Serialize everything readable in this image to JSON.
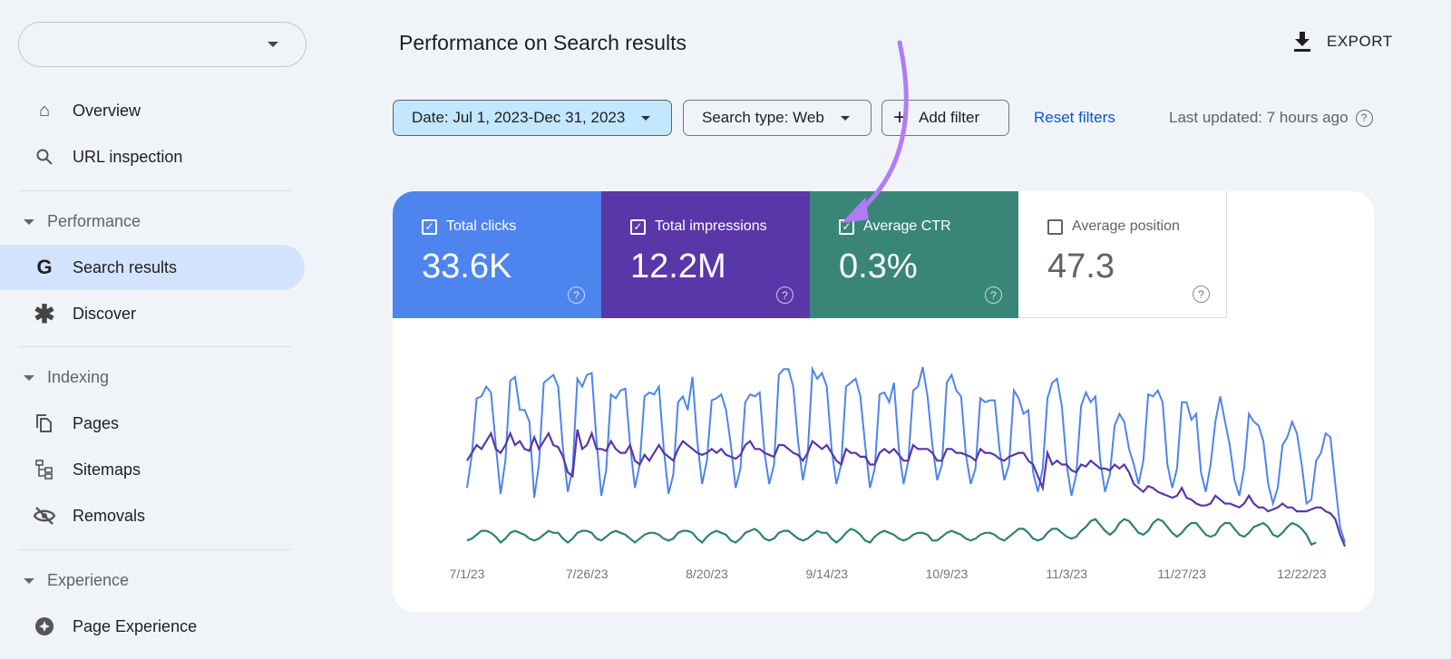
{
  "sidebar": {
    "property_selector": "",
    "items": {
      "overview": "Overview",
      "url_inspection": "URL inspection",
      "performance": "Performance",
      "search_results": "Search results",
      "discover": "Discover",
      "indexing": "Indexing",
      "pages": "Pages",
      "sitemaps": "Sitemaps",
      "removals": "Removals",
      "experience": "Experience",
      "page_experience": "Page Experience"
    }
  },
  "header": {
    "title": "Performance on Search results",
    "export": "EXPORT"
  },
  "filters": {
    "date": "Date: Jul 1, 2023-Dec 31, 2023",
    "search_type": "Search type: Web",
    "add_filter": "Add filter",
    "reset": "Reset filters",
    "last_updated": "Last updated: 7 hours ago"
  },
  "metrics": [
    {
      "label": "Total clicks",
      "value": "33.6K",
      "checked": true,
      "color": "#4e84ee"
    },
    {
      "label": "Total impressions",
      "value": "12.2M",
      "checked": true,
      "color": "#5a37a8"
    },
    {
      "label": "Average CTR",
      "value": "0.3%",
      "checked": true,
      "color": "#398679"
    },
    {
      "label": "Average position",
      "value": "47.3",
      "checked": false,
      "color": "#ffffff"
    }
  ],
  "annotation": {
    "arrow_color": "#b07cf5"
  },
  "chart_data": {
    "type": "line",
    "x_start": "7/1/23",
    "x_end": "12/31/23",
    "x_tick_labels": [
      "7/1/23",
      "7/26/23",
      "8/20/23",
      "9/14/23",
      "10/9/23",
      "11/3/23",
      "11/27/23",
      "12/22/23"
    ],
    "x_tick_day_offsets": [
      0,
      25,
      50,
      75,
      100,
      125,
      149,
      174
    ],
    "grid": false,
    "y_axis": "hidden (relative scale)",
    "series": [
      {
        "name": "Total clicks",
        "color": "#4e84ee",
        "values": [
          38,
          55,
          84,
          85,
          90,
          87,
          60,
          35,
          52,
          93,
          95,
          78,
          78,
          72,
          33,
          50,
          92,
          94,
          96,
          90,
          58,
          36,
          48,
          94,
          90,
          96,
          97,
          62,
          34,
          47,
          86,
          84,
          88,
          89,
          60,
          38,
          50,
          85,
          87,
          86,
          90,
          58,
          35,
          45,
          82,
          85,
          78,
          95,
          62,
          40,
          52,
          83,
          84,
          86,
          78,
          60,
          38,
          48,
          82,
          86,
          85,
          87,
          56,
          40,
          50,
          96,
          99,
          99,
          90,
          62,
          42,
          55,
          99,
          94,
          97,
          90,
          58,
          40,
          50,
          90,
          92,
          94,
          85,
          60,
          38,
          48,
          86,
          87,
          82,
          92,
          58,
          40,
          52,
          88,
          90,
          100,
          85,
          60,
          42,
          50,
          92,
          96,
          88,
          85,
          55,
          40,
          48,
          84,
          82,
          83,
          83,
          58,
          42,
          50,
          88,
          84,
          76,
          78,
          46,
          36,
          48,
          84,
          92,
          94,
          80,
          50,
          34,
          45,
          80,
          87,
          82,
          85,
          52,
          36,
          45,
          70,
          76,
          72,
          58,
          50,
          40,
          52,
          86,
          85,
          88,
          82,
          50,
          38,
          48,
          82,
          82,
          73,
          76,
          46,
          36,
          50,
          72,
          85,
          72,
          60,
          42,
          34,
          48,
          76,
          72,
          70,
          62,
          40,
          30,
          38,
          60,
          64,
          72,
          66,
          50,
          30,
          32,
          52,
          56,
          66,
          64,
          40,
          18,
          10
        ]
      },
      {
        "name": "Total impressions",
        "color": "#5a37a8",
        "values": [
          52,
          56,
          60,
          58,
          62,
          66,
          58,
          56,
          60,
          66,
          60,
          62,
          58,
          57,
          64,
          58,
          62,
          66,
          60,
          59,
          54,
          46,
          44,
          68,
          58,
          60,
          66,
          58,
          58,
          57,
          62,
          58,
          56,
          56,
          60,
          52,
          50,
          55,
          52,
          56,
          60,
          56,
          54,
          52,
          58,
          62,
          60,
          58,
          56,
          55,
          56,
          58,
          56,
          58,
          55,
          54,
          53,
          55,
          60,
          62,
          58,
          58,
          56,
          55,
          54,
          60,
          60,
          58,
          56,
          55,
          52,
          56,
          62,
          60,
          58,
          60,
          56,
          52,
          50,
          58,
          56,
          56,
          54,
          54,
          50,
          50,
          56,
          58,
          56,
          58,
          55,
          52,
          52,
          60,
          58,
          58,
          58,
          56,
          52,
          52,
          58,
          58,
          56,
          56,
          55,
          54,
          52,
          58,
          56,
          56,
          55,
          53,
          52,
          54,
          55,
          56,
          56,
          52,
          50,
          44,
          38,
          56,
          50,
          52,
          50,
          50,
          47,
          46,
          50,
          49,
          52,
          50,
          48,
          48,
          47,
          50,
          48,
          50,
          46,
          40,
          38,
          36,
          39,
          38,
          36,
          35,
          34,
          33,
          34,
          38,
          33,
          32,
          30,
          29,
          29,
          30,
          34,
          32,
          30,
          30,
          29,
          28,
          30,
          34,
          30,
          28,
          28,
          26,
          27,
          28,
          30,
          28,
          28,
          26,
          26,
          26,
          27,
          28,
          28,
          26,
          25,
          22,
          14,
          8
        ]
      },
      {
        "name": "Average CTR",
        "color": "#2e8270",
        "values": [
          11,
          12,
          14,
          16,
          16,
          15,
          13,
          10,
          12,
          15,
          16,
          15,
          14,
          12,
          11,
          12,
          14,
          16,
          15,
          15,
          12,
          10,
          12,
          15,
          16,
          16,
          15,
          12,
          11,
          13,
          15,
          16,
          15,
          14,
          12,
          10,
          12,
          14,
          15,
          15,
          14,
          12,
          11,
          12,
          15,
          16,
          16,
          15,
          12,
          10,
          13,
          15,
          16,
          15,
          14,
          11,
          10,
          12,
          15,
          16,
          17,
          15,
          12,
          11,
          12,
          15,
          16,
          16,
          14,
          12,
          11,
          12,
          14,
          16,
          15,
          15,
          12,
          10,
          12,
          15,
          17,
          16,
          14,
          11,
          10,
          13,
          15,
          16,
          15,
          14,
          12,
          11,
          12,
          14,
          15,
          15,
          14,
          11,
          11,
          13,
          15,
          16,
          15,
          14,
          12,
          11,
          12,
          14,
          15,
          15,
          14,
          12,
          11,
          13,
          15,
          17,
          17,
          15,
          12,
          11,
          12,
          15,
          17,
          17,
          15,
          13,
          12,
          13,
          16,
          18,
          21,
          22,
          19,
          16,
          14,
          16,
          20,
          22,
          21,
          18,
          15,
          14,
          16,
          20,
          22,
          21,
          18,
          15,
          13,
          15,
          18,
          20,
          20,
          17,
          14,
          13,
          14,
          18,
          20,
          20,
          17,
          14,
          13,
          15,
          18,
          19,
          20,
          18,
          14,
          13,
          15,
          18,
          20,
          19,
          17,
          14,
          9,
          10
        ]
      }
    ]
  }
}
